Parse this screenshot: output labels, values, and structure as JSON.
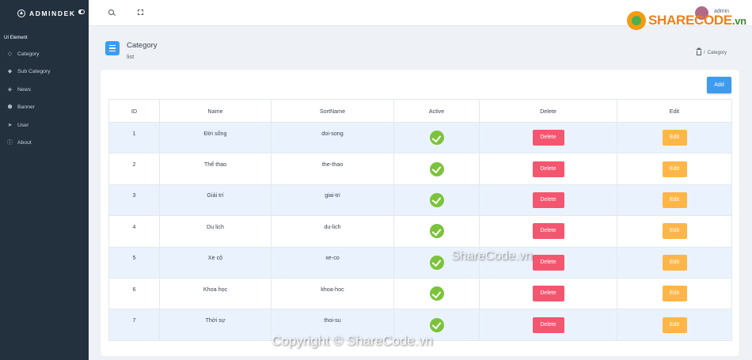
{
  "brand": {
    "name": "ADMINDEK"
  },
  "sidebar": {
    "section": "UI Element",
    "items": [
      {
        "label": "Category",
        "icon": "diamond-icon"
      },
      {
        "label": "Sub Category",
        "icon": "tag-icon"
      },
      {
        "label": "News",
        "icon": "layers-icon"
      },
      {
        "label": "Banner",
        "icon": "image-icon"
      },
      {
        "label": "User",
        "icon": "send-icon"
      },
      {
        "label": "About",
        "icon": "info-icon"
      }
    ]
  },
  "topbar": {
    "user": "admin"
  },
  "watermark": {
    "logo_main": "SHARECODE",
    "logo_suffix": ".vn",
    "center": "ShareCode.vn",
    "bottom": "Copyright © ShareCode.vn"
  },
  "page": {
    "title": "Category",
    "subtitle": "list",
    "breadcrumb": "Category"
  },
  "toolbar": {
    "add_label": "Add"
  },
  "table": {
    "headers": [
      "ID",
      "Name",
      "SortName",
      "Active",
      "Delete",
      "Edit"
    ],
    "delete_label": "Delete",
    "edit_label": "Edit",
    "rows": [
      {
        "id": "1",
        "name": "Đời sống",
        "sort": "doi-song",
        "active": true
      },
      {
        "id": "2",
        "name": "Thể thao",
        "sort": "the-thao",
        "active": true
      },
      {
        "id": "3",
        "name": "Giải trí",
        "sort": "giai-tri",
        "active": true
      },
      {
        "id": "4",
        "name": "Du lịch",
        "sort": "du-lich",
        "active": true
      },
      {
        "id": "5",
        "name": "Xe cộ",
        "sort": "xe-co",
        "active": true
      },
      {
        "id": "6",
        "name": "Khoa học",
        "sort": "khoa-hoc",
        "active": true
      },
      {
        "id": "7",
        "name": "Thời sự",
        "sort": "thoi-su",
        "active": true
      }
    ]
  },
  "colors": {
    "primary": "#3d9bf0",
    "danger": "#f4566f",
    "warning": "#ffb648",
    "success": "#7cc33b",
    "sidebar": "#23303e"
  }
}
